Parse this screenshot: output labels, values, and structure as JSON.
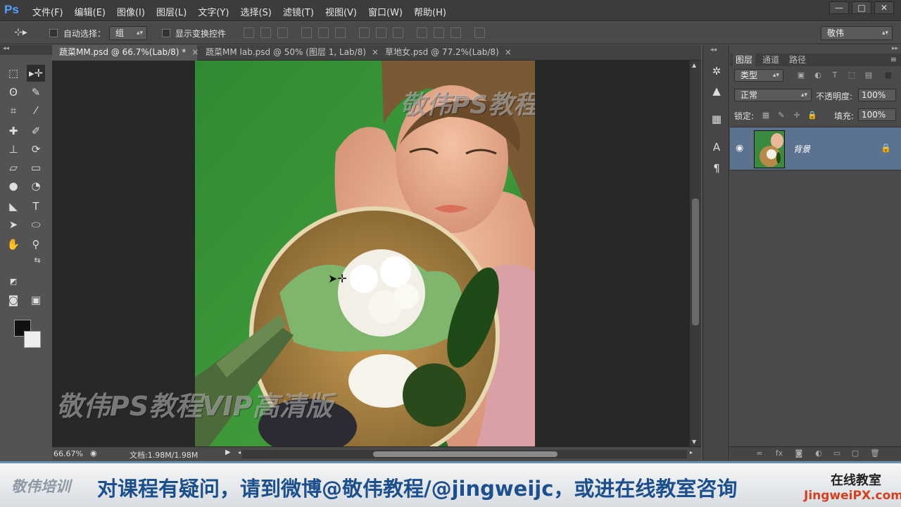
{
  "app": {
    "logo": "Ps",
    "menu": [
      "文件(F)",
      "编辑(E)",
      "图像(I)",
      "图层(L)",
      "文字(Y)",
      "选择(S)",
      "滤镜(T)",
      "视图(V)",
      "窗口(W)",
      "帮助(H)"
    ],
    "window_controls": {
      "minimize": "—",
      "maximize": "□",
      "close": "✕"
    }
  },
  "options_bar": {
    "auto_select_label": "自动选择：",
    "auto_select_value": "组",
    "show_transform_label": "显示变换控件",
    "workspace_value": "敬伟"
  },
  "tabs": [
    {
      "label": "蔬菜MM.psd @ 66.7%(Lab/8) *",
      "active": true,
      "close": "×"
    },
    {
      "label": "蔬菜MM lab.psd @ 50% (图层 1, Lab/8)",
      "active": false,
      "close": "×"
    },
    {
      "label": "草地女.psd @ 77.2%(Lab/8)",
      "active": false,
      "close": "×"
    }
  ],
  "canvas": {
    "watermark_text": "敬伟PS教程VIP高清版"
  },
  "status_bar": {
    "zoom": "66.67%",
    "doc_info": "文档:1.98M/1.98M"
  },
  "layers_panel": {
    "tabs": [
      "图层",
      "通道",
      "路径"
    ],
    "filter_kind": "类型",
    "blend_mode": "正常",
    "opacity_label": "不透明度:",
    "opacity_value": "100%",
    "lock_label": "锁定:",
    "fill_label": "填充:",
    "fill_value": "100%",
    "layers": [
      {
        "name": "背景",
        "visible": true,
        "locked": true,
        "selected": true
      }
    ]
  },
  "banner": {
    "brand": "敬伟培训",
    "message": "对课程有疑问，请到微博@敬伟教程/@jingweijc，或进在线教室咨询",
    "online_label": "在线教室",
    "site": "JingweiPX.com"
  },
  "colors": {
    "ps_blue": "#4ea1ff",
    "selected_layer": "#5b7390",
    "banner_text": "#1c4f8e",
    "banner_site": "#d5401f"
  }
}
